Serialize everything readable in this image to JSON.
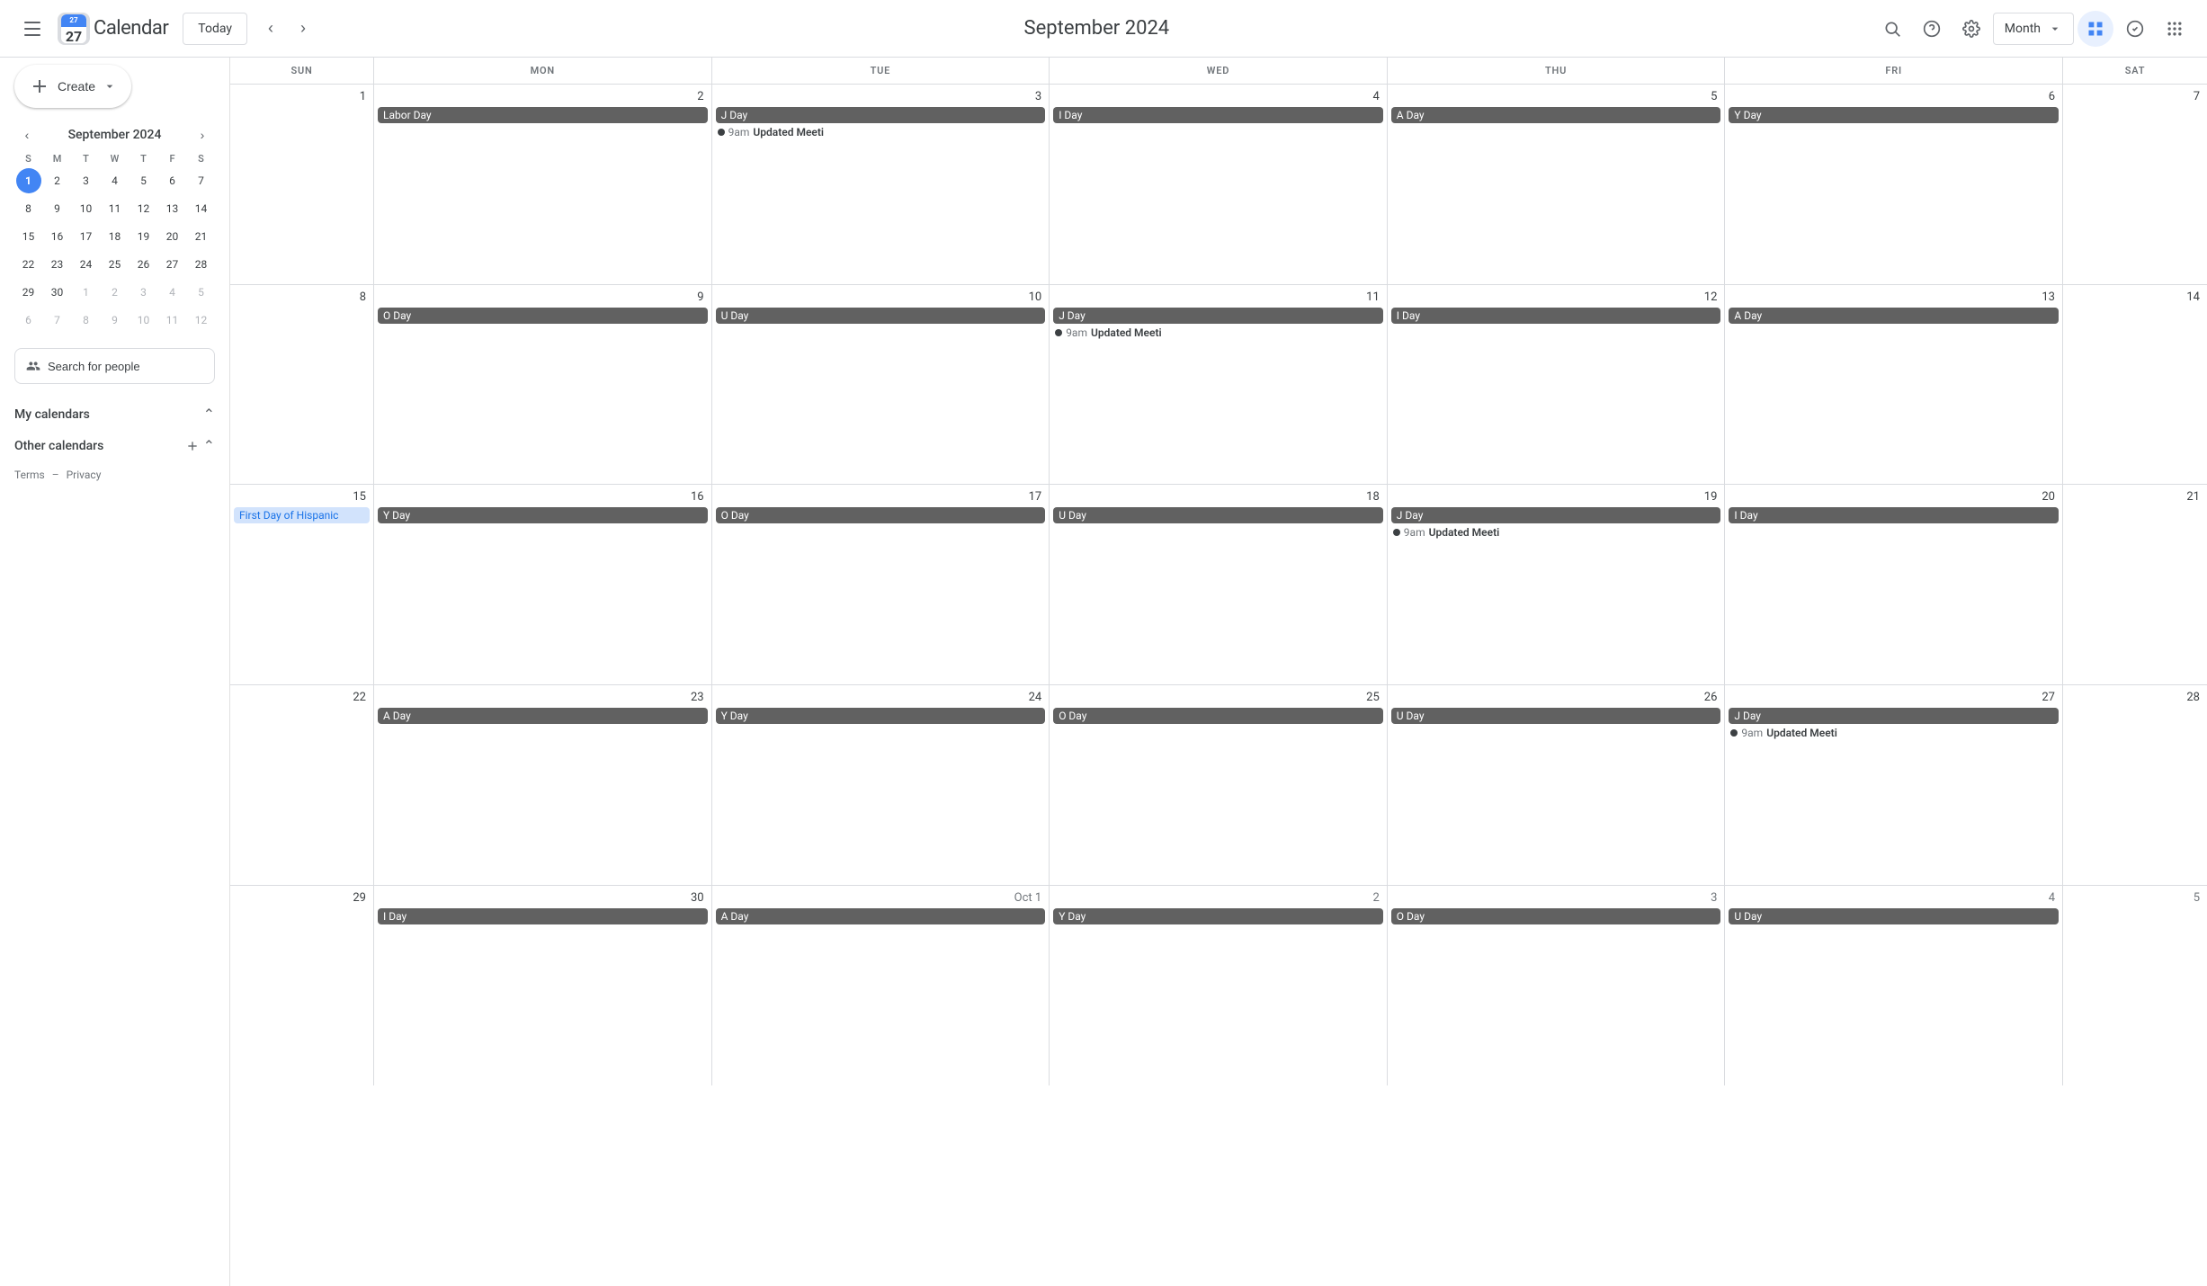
{
  "header": {
    "today_label": "Today",
    "title": "September 2024",
    "view_label": "Month",
    "search_placeholder": "Search"
  },
  "sidebar": {
    "create_label": "Create",
    "mini_cal": {
      "title": "September 2024",
      "day_headers": [
        "S",
        "M",
        "T",
        "W",
        "T",
        "F",
        "S"
      ],
      "weeks": [
        [
          {
            "day": 1,
            "today": true,
            "other": false
          },
          {
            "day": 2,
            "today": false,
            "other": false
          },
          {
            "day": 3,
            "today": false,
            "other": false
          },
          {
            "day": 4,
            "today": false,
            "other": false
          },
          {
            "day": 5,
            "today": false,
            "other": false
          },
          {
            "day": 6,
            "today": false,
            "other": false
          },
          {
            "day": 7,
            "today": false,
            "other": false
          }
        ],
        [
          {
            "day": 8,
            "today": false,
            "other": false
          },
          {
            "day": 9,
            "today": false,
            "other": false
          },
          {
            "day": 10,
            "today": false,
            "other": false
          },
          {
            "day": 11,
            "today": false,
            "other": false
          },
          {
            "day": 12,
            "today": false,
            "other": false
          },
          {
            "day": 13,
            "today": false,
            "other": false
          },
          {
            "day": 14,
            "today": false,
            "other": false
          }
        ],
        [
          {
            "day": 15,
            "today": false,
            "other": false
          },
          {
            "day": 16,
            "today": false,
            "other": false
          },
          {
            "day": 17,
            "today": false,
            "other": false
          },
          {
            "day": 18,
            "today": false,
            "other": false
          },
          {
            "day": 19,
            "today": false,
            "other": false
          },
          {
            "day": 20,
            "today": false,
            "other": false
          },
          {
            "day": 21,
            "today": false,
            "other": false
          }
        ],
        [
          {
            "day": 22,
            "today": false,
            "other": false
          },
          {
            "day": 23,
            "today": false,
            "other": false
          },
          {
            "day": 24,
            "today": false,
            "other": false
          },
          {
            "day": 25,
            "today": false,
            "other": false
          },
          {
            "day": 26,
            "today": false,
            "other": false
          },
          {
            "day": 27,
            "today": false,
            "other": false
          },
          {
            "day": 28,
            "today": false,
            "other": false
          }
        ],
        [
          {
            "day": 29,
            "today": false,
            "other": false
          },
          {
            "day": 30,
            "today": false,
            "other": false
          },
          {
            "day": 1,
            "today": false,
            "other": true
          },
          {
            "day": 2,
            "today": false,
            "other": true
          },
          {
            "day": 3,
            "today": false,
            "other": true
          },
          {
            "day": 4,
            "today": false,
            "other": true
          },
          {
            "day": 5,
            "today": false,
            "other": true
          }
        ],
        [
          {
            "day": 6,
            "today": false,
            "other": true
          },
          {
            "day": 7,
            "today": false,
            "other": true
          },
          {
            "day": 8,
            "today": false,
            "other": true
          },
          {
            "day": 9,
            "today": false,
            "other": true
          },
          {
            "day": 10,
            "today": false,
            "other": true
          },
          {
            "day": 11,
            "today": false,
            "other": true
          },
          {
            "day": 12,
            "today": false,
            "other": true
          }
        ]
      ]
    },
    "search_people_label": "Search for people",
    "my_calendars_label": "My calendars",
    "other_calendars_label": "Other calendars",
    "terms_label": "Terms",
    "privacy_label": "Privacy"
  },
  "calendar": {
    "day_headers": [
      "SUN",
      "MON",
      "TUE",
      "WED",
      "THU",
      "FRI",
      "SAT"
    ],
    "rows": [
      {
        "cells": [
          {
            "date": "Sep 1",
            "date_num": "1",
            "is_header_date": true,
            "other_month": false,
            "today": false,
            "events": []
          },
          {
            "date": "2",
            "date_num": "2",
            "other_month": false,
            "today": false,
            "events": [
              {
                "type": "chip",
                "label": "Labor Day",
                "color": "#616161"
              }
            ]
          },
          {
            "date": "3",
            "date_num": "3",
            "other_month": false,
            "today": false,
            "events": [
              {
                "type": "chip",
                "label": "J  Day",
                "color": "#616161"
              },
              {
                "type": "dot",
                "time": "9am",
                "title": "Updated Meeti"
              }
            ]
          },
          {
            "date": "4",
            "date_num": "4",
            "other_month": false,
            "today": false,
            "events": [
              {
                "type": "chip",
                "label": "I  Day",
                "color": "#616161"
              }
            ]
          },
          {
            "date": "5",
            "date_num": "5",
            "other_month": false,
            "today": false,
            "events": [
              {
                "type": "chip",
                "label": "A  Day",
                "color": "#616161"
              }
            ]
          },
          {
            "date": "6",
            "date_num": "6",
            "other_month": false,
            "today": false,
            "events": [
              {
                "type": "chip",
                "label": "Y  Day",
                "color": "#616161"
              }
            ]
          },
          {
            "date": "7",
            "date_num": "7",
            "other_month": false,
            "today": false,
            "events": []
          }
        ]
      },
      {
        "cells": [
          {
            "date": "8",
            "date_num": "8",
            "other_month": false,
            "today": false,
            "events": []
          },
          {
            "date": "9",
            "date_num": "9",
            "other_month": false,
            "today": false,
            "events": [
              {
                "type": "chip",
                "label": "O  Day",
                "color": "#616161"
              }
            ]
          },
          {
            "date": "10",
            "date_num": "10",
            "other_month": false,
            "today": false,
            "events": [
              {
                "type": "chip",
                "label": "U  Day",
                "color": "#616161"
              }
            ]
          },
          {
            "date": "11",
            "date_num": "11",
            "other_month": false,
            "today": false,
            "events": [
              {
                "type": "chip",
                "label": "J  Day",
                "color": "#616161"
              },
              {
                "type": "dot",
                "time": "9am",
                "title": "Updated Meeti"
              }
            ]
          },
          {
            "date": "12",
            "date_num": "12",
            "other_month": false,
            "today": false,
            "events": [
              {
                "type": "chip",
                "label": "I  Day",
                "color": "#616161"
              }
            ]
          },
          {
            "date": "13",
            "date_num": "13",
            "other_month": false,
            "today": false,
            "events": [
              {
                "type": "chip",
                "label": "A  Day",
                "color": "#616161"
              }
            ]
          },
          {
            "date": "14",
            "date_num": "14",
            "other_month": false,
            "today": false,
            "events": []
          }
        ]
      },
      {
        "cells": [
          {
            "date": "15",
            "date_num": "15",
            "other_month": false,
            "today": false,
            "events": [
              {
                "type": "chip",
                "label": "First Day of Hispanic",
                "color": "#8ab4f8",
                "text_color": "#1a73e8"
              }
            ]
          },
          {
            "date": "16",
            "date_num": "16",
            "other_month": false,
            "today": false,
            "events": [
              {
                "type": "chip",
                "label": "Y  Day",
                "color": "#616161"
              }
            ]
          },
          {
            "date": "17",
            "date_num": "17",
            "other_month": false,
            "today": false,
            "events": [
              {
                "type": "chip",
                "label": "O  Day",
                "color": "#616161"
              }
            ]
          },
          {
            "date": "18",
            "date_num": "18",
            "other_month": false,
            "today": false,
            "events": [
              {
                "type": "chip",
                "label": "U  Day",
                "color": "#616161"
              }
            ]
          },
          {
            "date": "19",
            "date_num": "19",
            "other_month": false,
            "today": false,
            "events": [
              {
                "type": "chip",
                "label": "J  Day",
                "color": "#616161"
              },
              {
                "type": "dot",
                "time": "9am",
                "title": "Updated Meeti"
              }
            ]
          },
          {
            "date": "20",
            "date_num": "20",
            "other_month": false,
            "today": false,
            "events": [
              {
                "type": "chip",
                "label": "I  Day",
                "color": "#616161"
              }
            ]
          },
          {
            "date": "21",
            "date_num": "21",
            "other_month": false,
            "today": false,
            "events": []
          }
        ]
      },
      {
        "cells": [
          {
            "date": "22",
            "date_num": "22",
            "other_month": false,
            "today": false,
            "events": []
          },
          {
            "date": "23",
            "date_num": "23",
            "other_month": false,
            "today": false,
            "events": [
              {
                "type": "chip",
                "label": "A  Day",
                "color": "#616161"
              }
            ]
          },
          {
            "date": "24",
            "date_num": "24",
            "other_month": false,
            "today": false,
            "events": [
              {
                "type": "chip",
                "label": "Y  Day",
                "color": "#616161"
              }
            ]
          },
          {
            "date": "25",
            "date_num": "25",
            "other_month": false,
            "today": false,
            "events": [
              {
                "type": "chip",
                "label": "O  Day",
                "color": "#616161"
              }
            ]
          },
          {
            "date": "26",
            "date_num": "26",
            "other_month": false,
            "today": false,
            "events": [
              {
                "type": "chip",
                "label": "U  Day",
                "color": "#616161"
              }
            ]
          },
          {
            "date": "27",
            "date_num": "27",
            "other_month": false,
            "today": false,
            "events": [
              {
                "type": "chip",
                "label": "J  Day",
                "color": "#616161"
              },
              {
                "type": "dot",
                "time": "9am",
                "title": "Updated Meeti"
              }
            ]
          },
          {
            "date": "28",
            "date_num": "28",
            "other_month": false,
            "today": false,
            "events": []
          }
        ]
      },
      {
        "cells": [
          {
            "date": "29",
            "date_num": "29",
            "other_month": false,
            "today": false,
            "events": []
          },
          {
            "date": "30",
            "date_num": "30",
            "other_month": false,
            "today": false,
            "events": [
              {
                "type": "chip",
                "label": "I  Day",
                "color": "#616161"
              }
            ]
          },
          {
            "date": "Oct 1",
            "date_num": "Oct 1",
            "other_month": true,
            "today": false,
            "events": [
              {
                "type": "chip",
                "label": "A  Day",
                "color": "#616161"
              }
            ]
          },
          {
            "date": "2",
            "date_num": "2",
            "other_month": true,
            "today": false,
            "events": [
              {
                "type": "chip",
                "label": "Y  Day",
                "color": "#616161"
              }
            ]
          },
          {
            "date": "3",
            "date_num": "3",
            "other_month": true,
            "today": false,
            "events": [
              {
                "type": "chip",
                "label": "O  Day",
                "color": "#616161"
              }
            ]
          },
          {
            "date": "4",
            "date_num": "4",
            "other_month": true,
            "today": false,
            "events": [
              {
                "type": "chip",
                "label": "U  Day",
                "color": "#616161"
              }
            ]
          },
          {
            "date": "5",
            "date_num": "5",
            "other_month": true,
            "today": false,
            "events": []
          }
        ]
      }
    ]
  }
}
